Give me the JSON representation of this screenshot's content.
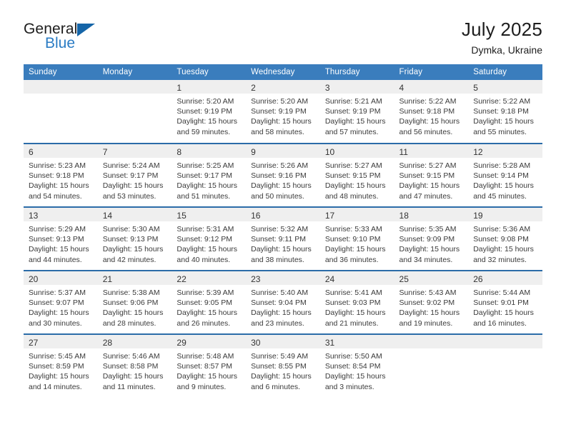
{
  "brand": {
    "line1": "General",
    "line2": "Blue",
    "triangle_color": "#1565a8",
    "blue_text_color": "#2b7cc4"
  },
  "header": {
    "title": "July 2025",
    "subtitle": "Dymka, Ukraine"
  },
  "theme": {
    "header_row_bg": "#3a7dbd",
    "row_separator": "#2b6ca8",
    "daynum_band_bg": "#efefef",
    "page_bg": "#ffffff",
    "text": "#3a3a3a"
  },
  "weekday_headers": [
    "Sunday",
    "Monday",
    "Tuesday",
    "Wednesday",
    "Thursday",
    "Friday",
    "Saturday"
  ],
  "labels": {
    "sunrise_prefix": "Sunrise: ",
    "sunset_prefix": "Sunset: ",
    "daylight_prefix": "Daylight: "
  },
  "weeks": [
    [
      {
        "day": "",
        "empty": true
      },
      {
        "day": "",
        "empty": true
      },
      {
        "day": "1",
        "sunrise": "Sunrise: 5:20 AM",
        "sunset": "Sunset: 9:19 PM",
        "daylight_l1": "Daylight: 15 hours",
        "daylight_l2": "and 59 minutes."
      },
      {
        "day": "2",
        "sunrise": "Sunrise: 5:20 AM",
        "sunset": "Sunset: 9:19 PM",
        "daylight_l1": "Daylight: 15 hours",
        "daylight_l2": "and 58 minutes."
      },
      {
        "day": "3",
        "sunrise": "Sunrise: 5:21 AM",
        "sunset": "Sunset: 9:19 PM",
        "daylight_l1": "Daylight: 15 hours",
        "daylight_l2": "and 57 minutes."
      },
      {
        "day": "4",
        "sunrise": "Sunrise: 5:22 AM",
        "sunset": "Sunset: 9:18 PM",
        "daylight_l1": "Daylight: 15 hours",
        "daylight_l2": "and 56 minutes."
      },
      {
        "day": "5",
        "sunrise": "Sunrise: 5:22 AM",
        "sunset": "Sunset: 9:18 PM",
        "daylight_l1": "Daylight: 15 hours",
        "daylight_l2": "and 55 minutes."
      }
    ],
    [
      {
        "day": "6",
        "sunrise": "Sunrise: 5:23 AM",
        "sunset": "Sunset: 9:18 PM",
        "daylight_l1": "Daylight: 15 hours",
        "daylight_l2": "and 54 minutes."
      },
      {
        "day": "7",
        "sunrise": "Sunrise: 5:24 AM",
        "sunset": "Sunset: 9:17 PM",
        "daylight_l1": "Daylight: 15 hours",
        "daylight_l2": "and 53 minutes."
      },
      {
        "day": "8",
        "sunrise": "Sunrise: 5:25 AM",
        "sunset": "Sunset: 9:17 PM",
        "daylight_l1": "Daylight: 15 hours",
        "daylight_l2": "and 51 minutes."
      },
      {
        "day": "9",
        "sunrise": "Sunrise: 5:26 AM",
        "sunset": "Sunset: 9:16 PM",
        "daylight_l1": "Daylight: 15 hours",
        "daylight_l2": "and 50 minutes."
      },
      {
        "day": "10",
        "sunrise": "Sunrise: 5:27 AM",
        "sunset": "Sunset: 9:15 PM",
        "daylight_l1": "Daylight: 15 hours",
        "daylight_l2": "and 48 minutes."
      },
      {
        "day": "11",
        "sunrise": "Sunrise: 5:27 AM",
        "sunset": "Sunset: 9:15 PM",
        "daylight_l1": "Daylight: 15 hours",
        "daylight_l2": "and 47 minutes."
      },
      {
        "day": "12",
        "sunrise": "Sunrise: 5:28 AM",
        "sunset": "Sunset: 9:14 PM",
        "daylight_l1": "Daylight: 15 hours",
        "daylight_l2": "and 45 minutes."
      }
    ],
    [
      {
        "day": "13",
        "sunrise": "Sunrise: 5:29 AM",
        "sunset": "Sunset: 9:13 PM",
        "daylight_l1": "Daylight: 15 hours",
        "daylight_l2": "and 44 minutes."
      },
      {
        "day": "14",
        "sunrise": "Sunrise: 5:30 AM",
        "sunset": "Sunset: 9:13 PM",
        "daylight_l1": "Daylight: 15 hours",
        "daylight_l2": "and 42 minutes."
      },
      {
        "day": "15",
        "sunrise": "Sunrise: 5:31 AM",
        "sunset": "Sunset: 9:12 PM",
        "daylight_l1": "Daylight: 15 hours",
        "daylight_l2": "and 40 minutes."
      },
      {
        "day": "16",
        "sunrise": "Sunrise: 5:32 AM",
        "sunset": "Sunset: 9:11 PM",
        "daylight_l1": "Daylight: 15 hours",
        "daylight_l2": "and 38 minutes."
      },
      {
        "day": "17",
        "sunrise": "Sunrise: 5:33 AM",
        "sunset": "Sunset: 9:10 PM",
        "daylight_l1": "Daylight: 15 hours",
        "daylight_l2": "and 36 minutes."
      },
      {
        "day": "18",
        "sunrise": "Sunrise: 5:35 AM",
        "sunset": "Sunset: 9:09 PM",
        "daylight_l1": "Daylight: 15 hours",
        "daylight_l2": "and 34 minutes."
      },
      {
        "day": "19",
        "sunrise": "Sunrise: 5:36 AM",
        "sunset": "Sunset: 9:08 PM",
        "daylight_l1": "Daylight: 15 hours",
        "daylight_l2": "and 32 minutes."
      }
    ],
    [
      {
        "day": "20",
        "sunrise": "Sunrise: 5:37 AM",
        "sunset": "Sunset: 9:07 PM",
        "daylight_l1": "Daylight: 15 hours",
        "daylight_l2": "and 30 minutes."
      },
      {
        "day": "21",
        "sunrise": "Sunrise: 5:38 AM",
        "sunset": "Sunset: 9:06 PM",
        "daylight_l1": "Daylight: 15 hours",
        "daylight_l2": "and 28 minutes."
      },
      {
        "day": "22",
        "sunrise": "Sunrise: 5:39 AM",
        "sunset": "Sunset: 9:05 PM",
        "daylight_l1": "Daylight: 15 hours",
        "daylight_l2": "and 26 minutes."
      },
      {
        "day": "23",
        "sunrise": "Sunrise: 5:40 AM",
        "sunset": "Sunset: 9:04 PM",
        "daylight_l1": "Daylight: 15 hours",
        "daylight_l2": "and 23 minutes."
      },
      {
        "day": "24",
        "sunrise": "Sunrise: 5:41 AM",
        "sunset": "Sunset: 9:03 PM",
        "daylight_l1": "Daylight: 15 hours",
        "daylight_l2": "and 21 minutes."
      },
      {
        "day": "25",
        "sunrise": "Sunrise: 5:43 AM",
        "sunset": "Sunset: 9:02 PM",
        "daylight_l1": "Daylight: 15 hours",
        "daylight_l2": "and 19 minutes."
      },
      {
        "day": "26",
        "sunrise": "Sunrise: 5:44 AM",
        "sunset": "Sunset: 9:01 PM",
        "daylight_l1": "Daylight: 15 hours",
        "daylight_l2": "and 16 minutes."
      }
    ],
    [
      {
        "day": "27",
        "sunrise": "Sunrise: 5:45 AM",
        "sunset": "Sunset: 8:59 PM",
        "daylight_l1": "Daylight: 15 hours",
        "daylight_l2": "and 14 minutes."
      },
      {
        "day": "28",
        "sunrise": "Sunrise: 5:46 AM",
        "sunset": "Sunset: 8:58 PM",
        "daylight_l1": "Daylight: 15 hours",
        "daylight_l2": "and 11 minutes."
      },
      {
        "day": "29",
        "sunrise": "Sunrise: 5:48 AM",
        "sunset": "Sunset: 8:57 PM",
        "daylight_l1": "Daylight: 15 hours",
        "daylight_l2": "and 9 minutes."
      },
      {
        "day": "30",
        "sunrise": "Sunrise: 5:49 AM",
        "sunset": "Sunset: 8:55 PM",
        "daylight_l1": "Daylight: 15 hours",
        "daylight_l2": "and 6 minutes."
      },
      {
        "day": "31",
        "sunrise": "Sunrise: 5:50 AM",
        "sunset": "Sunset: 8:54 PM",
        "daylight_l1": "Daylight: 15 hours",
        "daylight_l2": "and 3 minutes."
      },
      {
        "day": "",
        "empty": true
      },
      {
        "day": "",
        "empty": true
      }
    ]
  ]
}
